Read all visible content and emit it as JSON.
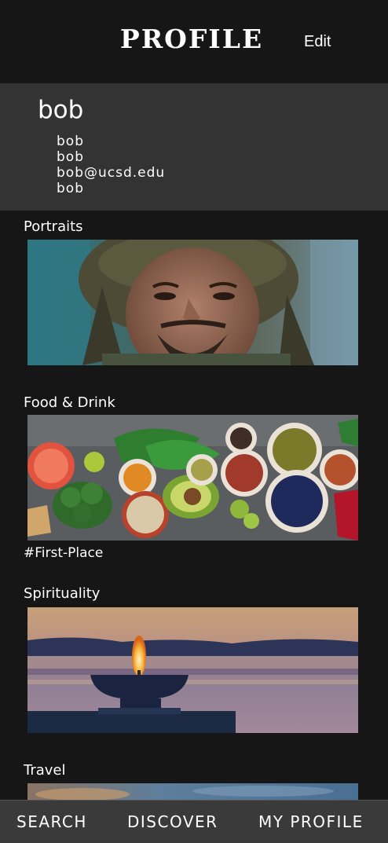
{
  "header": {
    "title": "PROFILE",
    "edit_label": "Edit"
  },
  "user": {
    "display_name": "bob",
    "details": [
      "bob",
      "bob",
      "bob@ucsd.edu",
      "bob"
    ]
  },
  "categories": [
    {
      "label": "Portraits",
      "tag": ""
    },
    {
      "label": "Food & Drink",
      "tag": "#First-Place"
    },
    {
      "label": "Spirituality",
      "tag": ""
    },
    {
      "label": "Travel",
      "tag": ""
    }
  ],
  "bottom_nav": {
    "items": [
      {
        "label": "SEARCH"
      },
      {
        "label": "DISCOVER"
      },
      {
        "label": "MY PROFILE"
      }
    ]
  },
  "colors": {
    "background": "#161616",
    "user_panel": "#333333",
    "bottom_nav": "#3a3a3a",
    "text": "#ffffff"
  }
}
